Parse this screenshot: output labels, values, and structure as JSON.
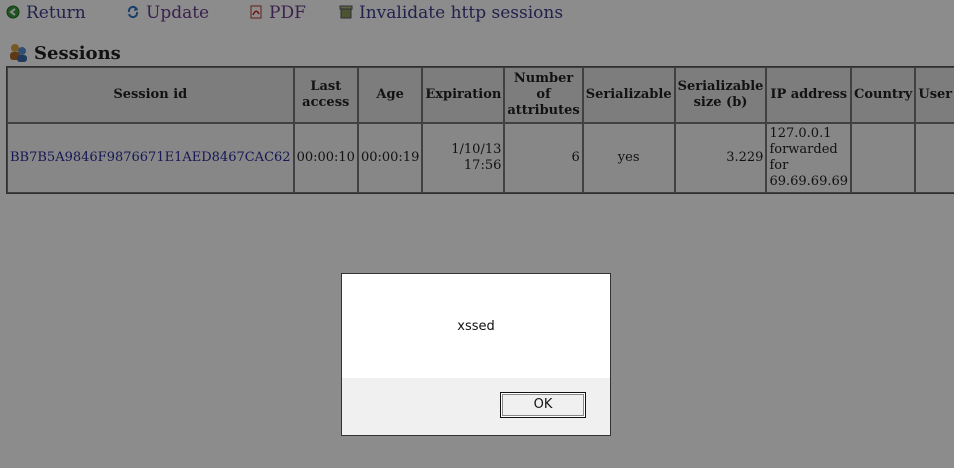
{
  "toolbar": {
    "return_label": "Return",
    "update_label": "Update",
    "pdf_label": "PDF",
    "invalidate_label": "Invalidate http sessions"
  },
  "section": {
    "title": "Sessions"
  },
  "table": {
    "headers": [
      "Session id",
      "Last access",
      "Age",
      "Expiration",
      "Number of attributes",
      "Serializable",
      "Serializable size (b)",
      "IP address",
      "Country",
      "User"
    ],
    "rows": [
      {
        "session_id": "BB7B5A9846F9876671E1AED8467CAC62",
        "last_access": "00:00:10",
        "age": "00:00:19",
        "expiration": "1/10/13 17:56",
        "attributes": "6",
        "serializable": "yes",
        "size": "3.229",
        "ip": "127.0.0.1 forwarded for 69.69.69.69",
        "country": "",
        "user": ""
      }
    ]
  },
  "dialog": {
    "message": "xssed",
    "ok_label": "OK"
  },
  "colors": {
    "link": "#3d3d8c",
    "overlay": "rgba(0,0,0,0.45)"
  }
}
